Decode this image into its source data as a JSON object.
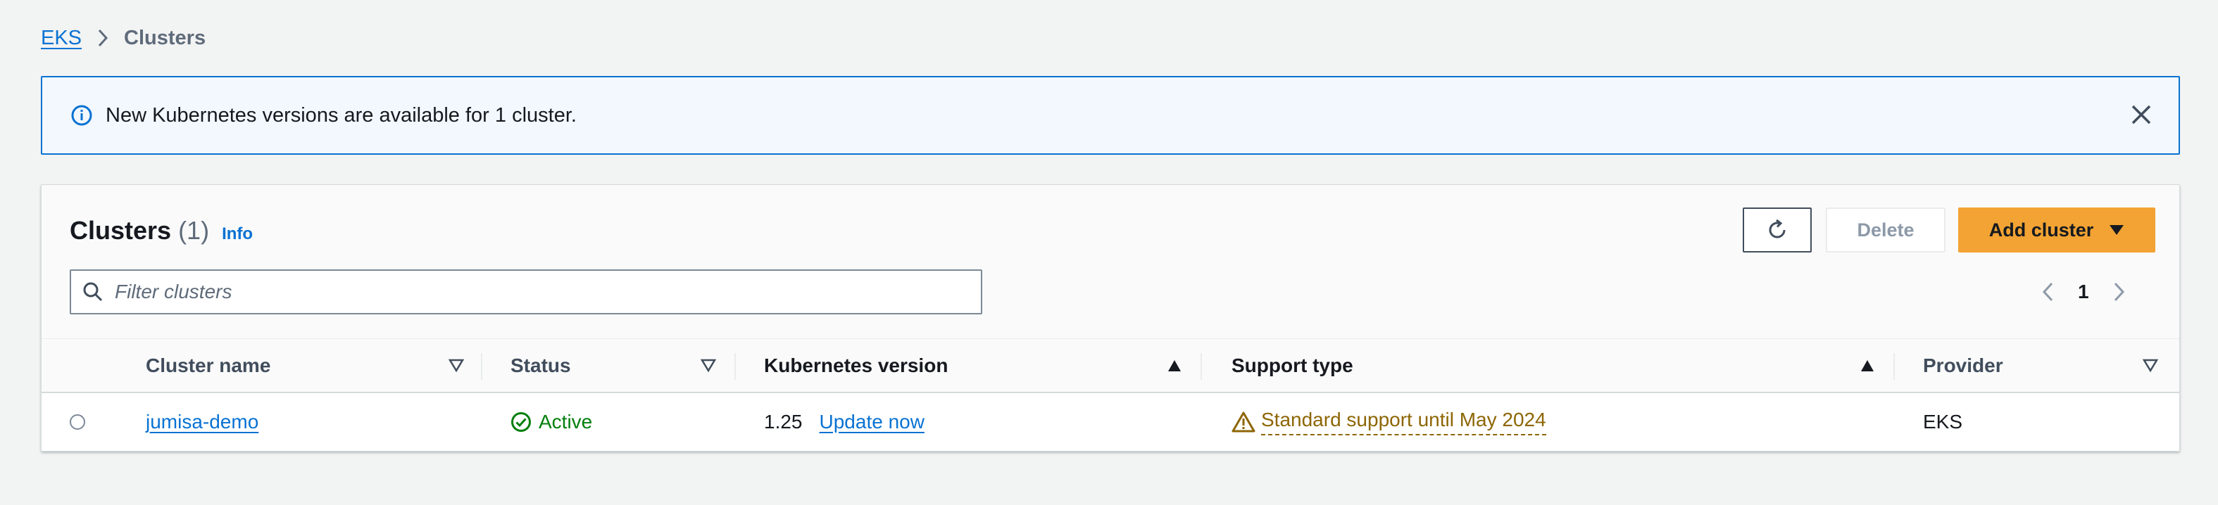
{
  "breadcrumb": {
    "root": "EKS",
    "current": "Clusters",
    "separator_icon": "chevron-right-icon"
  },
  "flash": {
    "message": "New Kubernetes versions are available for 1 cluster.",
    "icon": "info-icon",
    "close_icon": "close-icon"
  },
  "panel": {
    "title": "Clusters",
    "count": "(1)",
    "info_link": "Info",
    "actions": {
      "refresh_icon": "refresh-icon",
      "delete_label": "Delete",
      "add_label": "Add cluster",
      "add_caret_icon": "caret-down-icon"
    },
    "search": {
      "placeholder": "Filter clusters",
      "value": "",
      "icon": "search-icon"
    },
    "pagination": {
      "current_page": "1"
    }
  },
  "table": {
    "columns": [
      {
        "label": "Cluster name",
        "sort": "unsorted"
      },
      {
        "label": "Status",
        "sort": "unsorted"
      },
      {
        "label": "Kubernetes version",
        "sort": "ascending"
      },
      {
        "label": "Support type",
        "sort": "ascending"
      },
      {
        "label": "Provider",
        "sort": "unsorted"
      }
    ],
    "rows": [
      {
        "selected": false,
        "cluster_name": "jumisa-demo",
        "status": "Active",
        "status_icon": "check-circle-icon",
        "k8s_version": "1.25",
        "update_link": "Update now",
        "support_type": "Standard support until May 2024",
        "support_icon": "warning-icon",
        "provider": "EKS"
      }
    ]
  },
  "colors": {
    "link": "#0972d3",
    "primary_button": "#f2a333",
    "success": "#037f0c",
    "warning": "#8d6605",
    "info_border": "#0972d3",
    "background": "#f2f3f3"
  }
}
